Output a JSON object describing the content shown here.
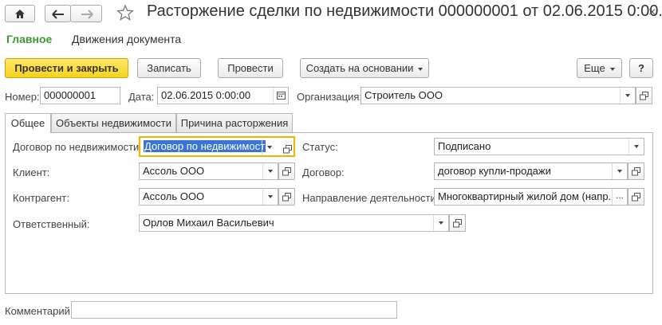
{
  "window": {
    "title": "Расторжение сделки по недвижимости 000000001 от 02.06.2015 0:00...",
    "close_label": "×"
  },
  "nav": {
    "main": "Главное",
    "movements": "Движения документа"
  },
  "toolbar": {
    "post_close": "Провести и закрыть",
    "save": "Записать",
    "post": "Провести",
    "create_basis": "Создать на основании",
    "more": "Еще",
    "help": "?"
  },
  "header": {
    "number_label": "Номер:",
    "number_value": "000000001",
    "date_label": "Дата:",
    "date_value": "02.06.2015  0:00:00",
    "org_label": "Организация:",
    "org_value": "Строитель ООО"
  },
  "tabs": [
    "Общее",
    "Объекты недвижимости",
    "Причина расторжения"
  ],
  "form": {
    "contract_re_label": "Договор по недвижимости:",
    "contract_re_value": "Договор по недвижимост",
    "client_label": "Клиент:",
    "client_value": "Ассоль ООО",
    "counterparty_label": "Контрагент:",
    "counterparty_value": "Ассоль ООО",
    "responsible_label": "Ответственный:",
    "responsible_value": "Орлов Михаил Васильевич",
    "status_label": "Статус:",
    "status_value": "Подписано",
    "contract_label": "Договор:",
    "contract_value": "договор купли-продажи",
    "direction_label": "Направление деятельности:",
    "direction_value": "Многоквартирный жилой дом (напр. де",
    "more_symbol": "..."
  },
  "comment": {
    "label": "Комментарий:",
    "value": ""
  }
}
